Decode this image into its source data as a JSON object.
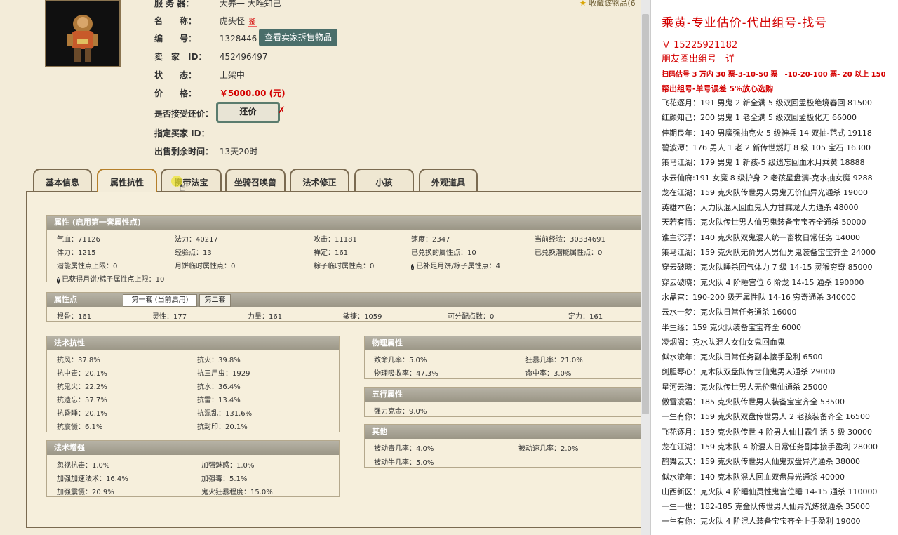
{
  "detail": {
    "server_label": "服 务 器：",
    "server_value": "大养一 大唯知己",
    "name_label": "名　　称：",
    "name_value": "虎头怪",
    "name_badge": "鉴",
    "id_label": "编　　号：",
    "id_value": "1328446",
    "view_seller_btn": "查看卖家拆售物品",
    "seller_label": "卖　家　ID：",
    "seller_value": "452496497",
    "status_label": "状　　态：",
    "status_value": "上架中",
    "price_label": "价　　格：",
    "price_value": "￥5000.00 (元)",
    "counter_label": "是否接受还价：",
    "counter_btn": "还价",
    "buyer_label": "指定买家 ID：",
    "time_label": "出售剩余时间：",
    "time_value": "13天20时",
    "fav_text": "收藏该物品"
  },
  "tabs": [
    "基本信息",
    "属性抗性",
    "携带法宝",
    "坐骑召唤兽",
    "法术修正",
    "小孩",
    "外观道具"
  ],
  "attributes": {
    "title": "属性 (启用第一套属性点)",
    "rows": [
      [
        "气血：71126",
        "法力：40217",
        "攻击：11181",
        "速度：2347",
        "当前经验：30334691"
      ],
      [
        "体力：1215",
        "经验点：13",
        "禅定：161",
        "已兑换的属性点：10",
        "已兑换潜能属性点：0"
      ],
      [
        "潜能属性点上限：0",
        "月饼临时属性点：0",
        "粽子临时属性点：0",
        "已补足月饼/粽子属性点：4"
      ],
      [
        "已获得月饼/粽子属性点上限：10"
      ]
    ]
  },
  "points": {
    "title": "属性点",
    "tab1": "第一套 (当前启用)",
    "tab2": "第二套",
    "row": [
      "根骨：161",
      "灵性：177",
      "力量：161",
      "敏捷：1059",
      "可分配点数：0",
      "定力：161"
    ]
  },
  "resist": {
    "title": "法术抗性",
    "left": [
      "抗风：37.8%",
      "抗中毒：20.1%",
      "抗鬼火：22.2%",
      "抗遗忘：57.7%",
      "抗昏睡：20.1%",
      "抗震慑：6.1%"
    ],
    "right": [
      "抗火：39.8%",
      "抗三尸虫：1929",
      "抗水：36.4%",
      "抗雷：13.4%",
      "抗混乱：131.6%",
      "抗封印：20.1%"
    ]
  },
  "enhance": {
    "title": "法术增强",
    "left": [
      "忽视抗毒：1.0%",
      "加强加速法术：16.4%",
      "加强震慑：20.9%"
    ],
    "right": [
      "加强魅惑：1.0%",
      "加强毒：5.1%",
      "鬼火狂暴程度：15.0%"
    ]
  },
  "physical": {
    "title": "物理属性",
    "left": [
      "致命几率：5.0%",
      "物理吸收率：47.3%"
    ],
    "right": [
      "狂暴几率：21.0%",
      "命中率：3.0%"
    ]
  },
  "five": {
    "title": "五行属性",
    "left": [
      "强力克金：9.0%"
    ]
  },
  "other": {
    "title": "其他",
    "left": [
      "被动毒几率：4.0%",
      "被动牛几率：5.0%"
    ],
    "right": [
      "被动速几率：2.0%"
    ]
  },
  "right_panel": {
    "title": "乘黄-专业估价-代出组号-找号",
    "contact": "Ｖ 15225921182",
    "contact2": "朋友圈出组号　详",
    "line1": "扫码估号 3 万内 30 票-3-10-50 票　-10-20-100 票- 20 以上 150",
    "line2": "帮出组号-单号误差 5%放心选购",
    "items": [
      "飞花逐月：191 男鬼 2 新全满 5 级双回孟极绝境春回 81500",
      "红颜知己：200 男鬼 1 老全满 5 级双回孟极化无 66000",
      "佳期良年：140 男魔强抽克火 5 级神兵 14 双抽-范式 19118",
      "碧波潭：176 男人 1 老 2 新传世燃灯 8 级 105 宝石 16300",
      "策马江湖：179 男鬼 1 新孩-5 级遗忘回血水月乘黄 18888",
      "水云仙府:191 女魔 8 级护身 2 老孩星盘满-克水抽女魔 9288",
      "龙在江湖：159 克火队传世男人男鬼无价仙异光通杀 19000",
      "英雄本色：大力队混人回血鬼大力甘霖龙大力通杀 48000",
      "天若有情：克火队传世男人仙男鬼装备宝宝齐全通杀 50000",
      "谁主沉浮：140 克火队双鬼混人统一畜牧日常任务 14000",
      "策马江湖：159 克火队无价男人男仙男鬼装备宝宝齐全 24000",
      "穿云破晓：克火队睡杀回气体力 7 级 14-15 灵猴穷奇 85000",
      "穿云破晓：克火队 4 阶睡宫位 6 阶龙 14-15 通杀 190000",
      "水晶宫：190-200 级无属性队 14-16 穷奇通杀 340000",
      "云水一梦：克火队日常任务通杀 16000",
      "半生缘：159 克火队装备宝宝齐全 6000",
      "凌烟阁：克水队混人女仙女鬼回血鬼",
      "似水流年：克火队日常任务副本接手盈利 6500",
      "剑胆琴心：克木队双盘队传世仙鬼男人通杀 29000",
      "星河云海：克火队传世男人无价鬼仙通杀 25000",
      "傲雪凌霜：185 克火队传世男人装备宝宝齐全 53500",
      "一生有你：159 克火队双盘传世男人 2 老孩装备齐全 16500",
      "飞花逐月：159 克火队传世 4 阶男人仙甘霖生活 5 级 30000",
      "龙在江湖：159 克木队 4 阶混人日常任务副本接手盈利 28000",
      "鹤舞云天：159 克火队传世男人仙鬼双盘异光通杀 38000",
      "似水流年：140 克木队混人回血双盘异光通杀 40000",
      "山西新区：克火队 4 阶睡仙灵性鬼宫位睡 14-15 通杀 110000",
      "一生一世：182-185 克金队传世男人仙异光炼狱通杀 35000",
      "一生有你：克火队 4 阶混人装备宝宝齐全上手盈利 19000"
    ]
  }
}
